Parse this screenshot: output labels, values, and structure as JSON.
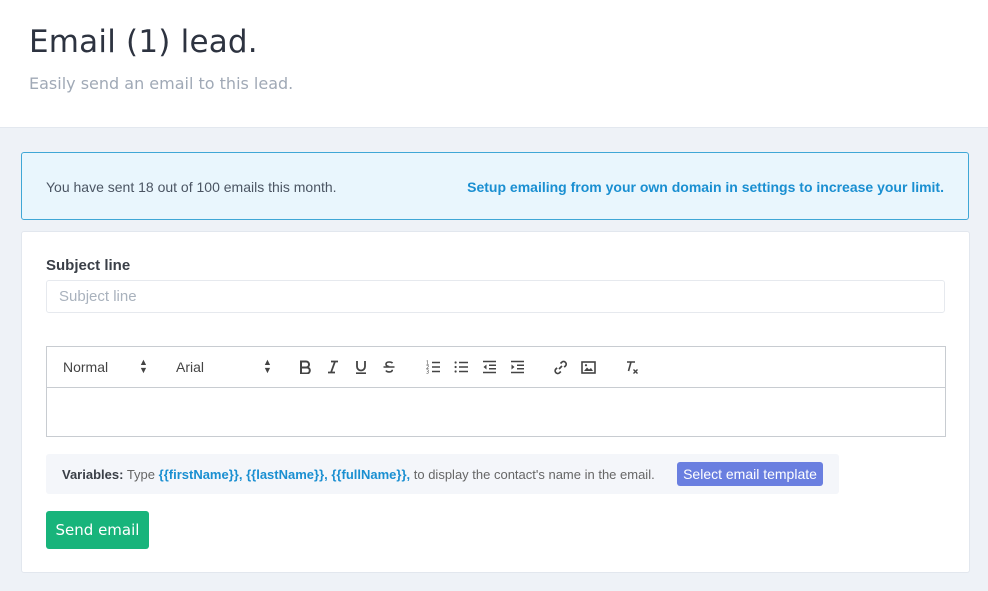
{
  "header": {
    "title": "Email (1) lead.",
    "subtitle": "Easily send an email to this lead."
  },
  "notice": {
    "text": "You have sent 18 out of 100 emails this month.",
    "link": "Setup emailing from your own domain in settings to increase your limit.",
    "sent": 18,
    "limit": 100
  },
  "form": {
    "subject_label": "Subject line",
    "subject_placeholder": "Subject line",
    "subject_value": ""
  },
  "toolbar": {
    "style_selected": "Normal",
    "font_selected": "Arial",
    "buttons": [
      "bold-icon",
      "italic-icon",
      "underline-icon",
      "strikethrough-icon",
      "ordered-list-icon",
      "bullet-list-icon",
      "outdent-icon",
      "indent-icon",
      "link-icon",
      "image-icon",
      "clear-format-icon"
    ]
  },
  "variables": {
    "label": "Variables:",
    "prefix": "Type",
    "first": "{{firstName}},",
    "last": "{{lastName}},",
    "full": "{{fullName}},",
    "suffix": "to display the contact's name in the email.",
    "template_button": "Select email template"
  },
  "actions": {
    "send_label": "Send email"
  },
  "colors": {
    "accent": "#1a8fd1",
    "send": "#18b47b",
    "template": "#6a7fe0",
    "notice_bg": "#e9f6fd",
    "notice_border": "#3fa7d6"
  }
}
